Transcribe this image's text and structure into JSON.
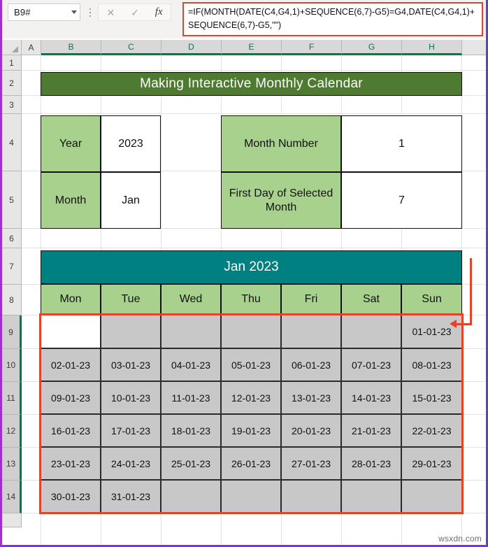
{
  "formula_bar": {
    "name_box_value": "B9#",
    "cancel_icon": "close-icon",
    "confirm_icon": "check-icon",
    "function_icon": "fx-icon",
    "formula": "=IF(MONTH(DATE(C4,G4,1)+SEQUENCE(6,7)-G5)=G4,DATE(C4,G4,1)+SEQUENCE(6,7)-G5,\"\")"
  },
  "grid": {
    "column_headers": [
      "A",
      "B",
      "C",
      "D",
      "E",
      "F",
      "G",
      "H"
    ],
    "selected_columns": [
      "B",
      "C",
      "D",
      "E",
      "F",
      "G",
      "H"
    ],
    "row_headers": [
      "1",
      "2",
      "3",
      "4",
      "5",
      "6",
      "7",
      "8",
      "9",
      "10",
      "11",
      "12",
      "13",
      "14"
    ],
    "selected_rows": [
      "9",
      "10",
      "11",
      "12",
      "13",
      "14"
    ]
  },
  "title_banner": {
    "text": "Making Interactive Monthly Calendar",
    "background": "#4E7B31",
    "text_color": "#FFFFFF"
  },
  "inputs": {
    "left": [
      {
        "label": "Year",
        "value": "2023"
      },
      {
        "label": "Month",
        "value": "Jan"
      }
    ],
    "right": [
      {
        "label": "Month Number",
        "value": "1"
      },
      {
        "label": "First Day of Selected Month",
        "value": "7"
      }
    ],
    "label_background": "#A9D18E",
    "value_background": "#FFFFFF"
  },
  "calendar": {
    "title": "Jan 2023",
    "title_background": "#008080",
    "day_headers": [
      "Mon",
      "Tue",
      "Wed",
      "Thu",
      "Fri",
      "Sat",
      "Sun"
    ],
    "day_header_background": "#A9D18E",
    "cell_background": "#C8C8C8",
    "active_cell_background": "#FFFFFF",
    "weeks": [
      [
        "",
        "",
        "",
        "",
        "",
        "",
        "01-01-23"
      ],
      [
        "02-01-23",
        "03-01-23",
        "04-01-23",
        "05-01-23",
        "06-01-23",
        "07-01-23",
        "08-01-23"
      ],
      [
        "09-01-23",
        "10-01-23",
        "11-01-23",
        "12-01-23",
        "13-01-23",
        "14-01-23",
        "15-01-23"
      ],
      [
        "16-01-23",
        "17-01-23",
        "18-01-23",
        "19-01-23",
        "20-01-23",
        "21-01-23",
        "22-01-23"
      ],
      [
        "23-01-23",
        "24-01-23",
        "25-01-23",
        "26-01-23",
        "27-01-23",
        "28-01-23",
        "29-01-23"
      ],
      [
        "30-01-23",
        "31-01-23",
        "",
        "",
        "",
        "",
        ""
      ]
    ]
  },
  "annotation": {
    "color": "#E0442B",
    "arrow_icon": "left-arrow-icon"
  },
  "watermark": "wsxdn.com"
}
